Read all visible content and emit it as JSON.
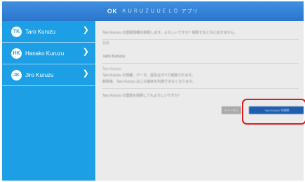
{
  "window": {
    "logo": "OK",
    "title": "ＫＵＲＵＺＵＵＥＬＯ アプリ"
  },
  "sidebar": {
    "items": [
      {
        "initials": "TK",
        "name": "Taro Kuruzu"
      },
      {
        "initials": "HK",
        "name": "Hanako Kuruzu"
      },
      {
        "initials": "JK",
        "name": "Jiro Kuruzu"
      }
    ]
  },
  "content": {
    "line1": "Taro Kuruzu の登録情報を削除します。よろしいですか？削除すると元に戻せません。",
    "label1": "氏名",
    "name": "Taro Kuruzu",
    "label2": "Taro Kuruzu",
    "detail1": "Taro Kuruzu の情報、データ、設定はすべて削除されます。",
    "detail2": "削除後、Taro Kuruzu はこの端末を利用できなくなります。",
    "note": "Taro Kuruzu の登録を削除してもよろしいですか？",
    "cancel_label": "キャンセル",
    "confirm_label": "Taro Kuruzu を削除"
  },
  "colors": {
    "sidebar": "#1d9fe6",
    "titlebar": "#2a76cd",
    "confirm": "#1f5fae",
    "highlight": "#e0191f"
  }
}
